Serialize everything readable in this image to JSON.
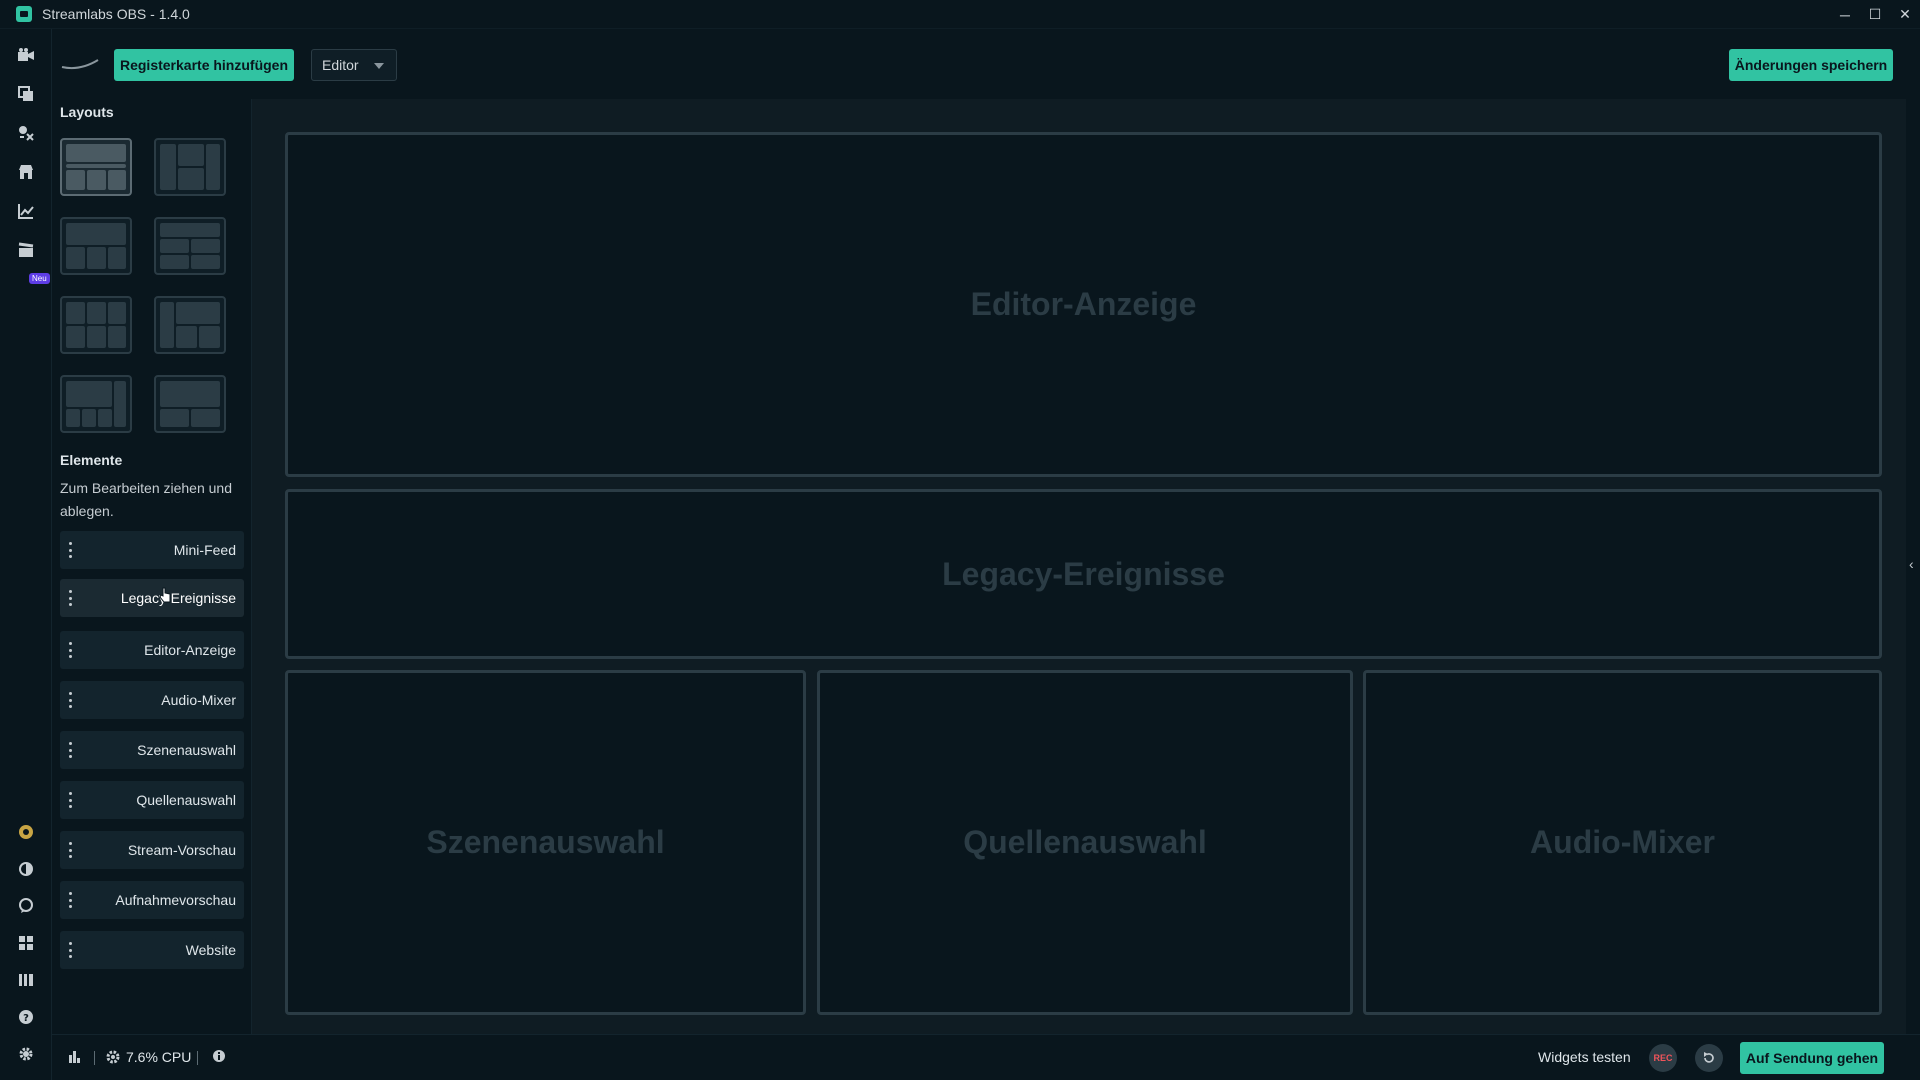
{
  "window": {
    "title": "Streamlabs OBS - 1.4.0",
    "controls": [
      "─",
      "☐",
      "✕"
    ]
  },
  "iconbar": {
    "icons": [
      "editor-icon",
      "themes-icon",
      "apps-icon",
      "store-icon",
      "dashboard-icon",
      "studio-mode-icon",
      "prime-icon",
      "dark-mode-icon",
      "chat-icon",
      "layout-icon",
      "library-icon",
      "help-icon",
      "settings-icon"
    ],
    "new_badge": "Neu"
  },
  "toolbar": {
    "add_tab_label": "Registerkarte hinzufügen",
    "editor_select_value": "Editor",
    "save_label": "Änderungen speichern"
  },
  "sidebar": {
    "layouts_heading": "Layouts",
    "elements_heading": "Elemente",
    "elements_hint": "Zum Bearbeiten ziehen und ablegen.",
    "elements": [
      {
        "label": "Mini-Feed"
      },
      {
        "label": "Legacy-Ereignisse"
      },
      {
        "label": "Editor-Anzeige"
      },
      {
        "label": "Audio-Mixer"
      },
      {
        "label": "Szenenauswahl"
      },
      {
        "label": "Quellenauswahl"
      },
      {
        "label": "Stream-Vorschau"
      },
      {
        "label": "Aufnahmevorschau"
      },
      {
        "label": "Website"
      }
    ]
  },
  "canvas": {
    "slots": [
      {
        "label": "Editor-Anzeige"
      },
      {
        "label": "Legacy-Ereignisse"
      },
      {
        "label": "Szenenauswahl"
      },
      {
        "label": "Quellenauswahl"
      },
      {
        "label": "Audio-Mixer"
      }
    ]
  },
  "footer": {
    "cpu": "7.6% CPU",
    "test_widgets_label": "Widgets testen",
    "rec_label": "REC",
    "go_live_label": "Auf Sendung gehen"
  },
  "colors": {
    "accent": "#31c3a2",
    "background": "#09161d",
    "rec": "#f0545a"
  }
}
